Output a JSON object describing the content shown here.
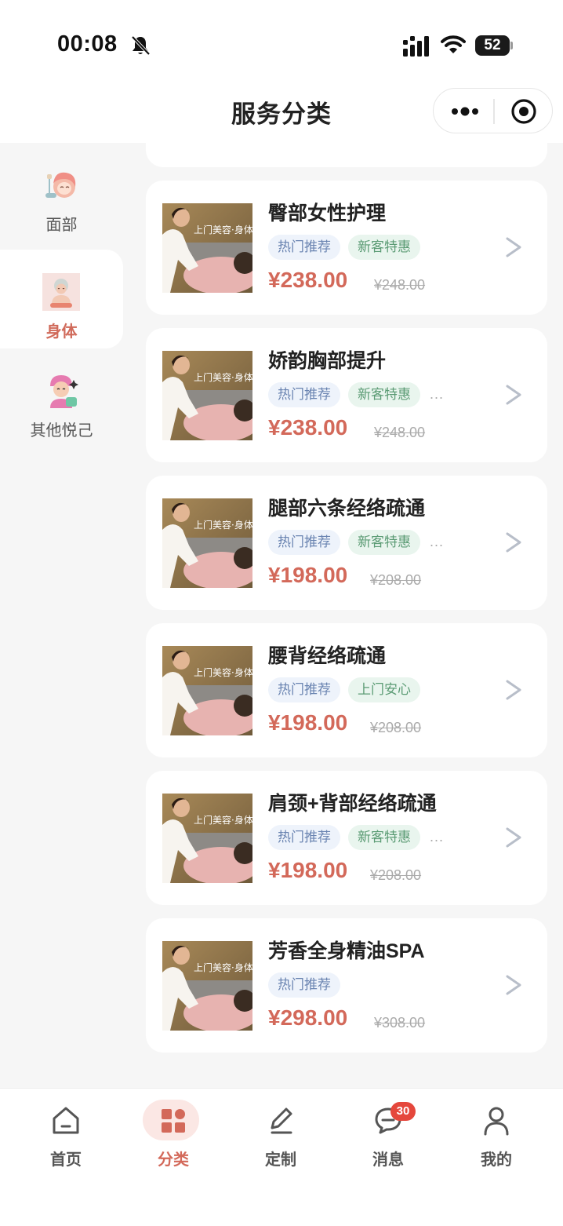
{
  "status_bar": {
    "time": "00:08",
    "battery": "52"
  },
  "nav": {
    "title": "服务分类"
  },
  "sidebar": {
    "items": [
      {
        "label": "面部",
        "icon": "face-care-icon",
        "active": false
      },
      {
        "label": "身体",
        "icon": "body-care-icon",
        "active": true
      },
      {
        "label": "其他悦己",
        "icon": "self-care-icon",
        "active": false
      }
    ]
  },
  "services": [
    {
      "title": "臀部女性护理",
      "tags": [
        "热门推荐",
        "新客特惠"
      ],
      "more": "",
      "price": "¥238.00",
      "original": "¥248.00"
    },
    {
      "title": "娇韵胸部提升",
      "tags": [
        "热门推荐",
        "新客特惠"
      ],
      "more": "...",
      "price": "¥238.00",
      "original": "¥248.00"
    },
    {
      "title": "腿部六条经络疏通",
      "tags": [
        "热门推荐",
        "新客特惠"
      ],
      "more": "...",
      "price": "¥198.00",
      "original": "¥208.00"
    },
    {
      "title": "腰背经络疏通",
      "tags": [
        "热门推荐",
        "上门安心"
      ],
      "more": "",
      "price": "¥198.00",
      "original": "¥208.00"
    },
    {
      "title": "肩颈+背部经络疏通",
      "tags": [
        "热门推荐",
        "新客特惠"
      ],
      "more": "...",
      "price": "¥198.00",
      "original": "¥208.00"
    },
    {
      "title": "芳香全身精油SPA",
      "tags": [
        "热门推荐"
      ],
      "more": "",
      "price": "¥298.00",
      "original": "¥308.00"
    }
  ],
  "thumb_text": "上门美容·身体",
  "arrow_glyph": ">",
  "tabs": [
    {
      "label": "首页",
      "icon": "home-icon",
      "active": false
    },
    {
      "label": "分类",
      "icon": "category-grid-icon",
      "active": true
    },
    {
      "label": "定制",
      "icon": "edit-pen-icon",
      "active": false
    },
    {
      "label": "消息",
      "icon": "message-icon",
      "active": false
    },
    {
      "label": "我的",
      "icon": "profile-icon",
      "active": false
    }
  ],
  "message_badge": "30",
  "colors": {
    "accent": "#d3695a",
    "hot_tag": "#6a84b1",
    "new_tag": "#5b9b74",
    "sidebar_bg": "#f6f6f6"
  }
}
